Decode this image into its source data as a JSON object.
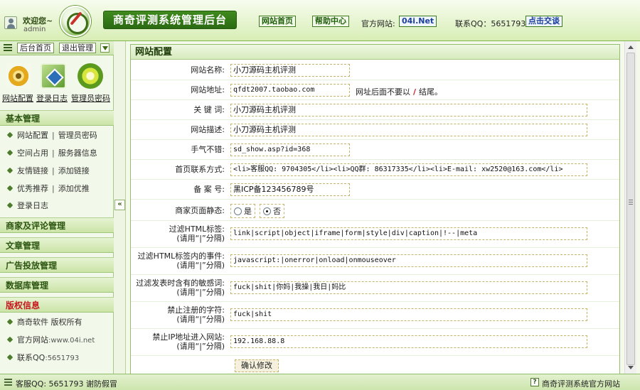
{
  "header": {
    "welcome": "欢迎您~",
    "username": "admin",
    "system_title": "商奇评测系统管理后台",
    "nav_home": "网站首页",
    "nav_help": "帮助中心",
    "official_label": "官方网站:",
    "official_site": "04i.Net",
    "qq_label": "联系QQ：5651793",
    "chat_button": "点击交谈"
  },
  "sidebar": {
    "top_buttons": [
      "后台首页",
      "退出管理"
    ],
    "quick_links": [
      "网站配置",
      "登录日志",
      "管理员密码"
    ],
    "sections": [
      {
        "title": "基本管理"
      },
      {
        "title": "商家及评论管理"
      },
      {
        "title": "文章管理"
      },
      {
        "title": "广告投放管理"
      },
      {
        "title": "数据库管理"
      },
      {
        "title": "版权信息"
      }
    ],
    "basic_items": [
      {
        "a": "网站配置",
        "b": "管理员密码"
      },
      {
        "a": "空间占用",
        "b": "服务器信息"
      },
      {
        "a": "友情链接",
        "b": "添加链接"
      },
      {
        "a": "优秀推荐",
        "b": "添加优推"
      },
      {
        "a": "登录日志",
        "b": ""
      }
    ],
    "copyright_items": [
      {
        "a": "商奇软件",
        "b": "版权所有"
      },
      {
        "a": "官方网站",
        "b": ":www.04i.net"
      },
      {
        "a": "联系QQ",
        "b": ":5651793"
      }
    ],
    "splitter_glyph": "«"
  },
  "main": {
    "panel_title": "网站配置",
    "fields": {
      "site_name": {
        "label": "网站名称:",
        "value": "小刀源码主机评测"
      },
      "site_url": {
        "label": "网站地址:",
        "value": "qfdt2007.taobao.com"
      },
      "site_url_note_a": "网址后面不要以",
      "site_url_note_slash": "/",
      "site_url_note_b": "结尾。",
      "keywords": {
        "label": "关 键 词:",
        "value": "小刀源码主机评测"
      },
      "description": {
        "label": "网站描述:",
        "value": "小刀源码主机评测"
      },
      "lucky": {
        "label": "手气不错:",
        "value": "sd_show.asp?id=368"
      },
      "contact": {
        "label": "首页联系方式:",
        "value": "<li>客服QQ: 9704305</li><li>QQ群: 86317335</li><li>E-mail: xw2520@163.com</li>"
      },
      "icp": {
        "label": "备 案 号:",
        "value": "黑ICP备123456789号"
      },
      "static": {
        "label": "商家页面静态:",
        "option_yes": "是",
        "option_no": "否"
      },
      "filter_html": {
        "label_a": "过滤HTML标签:",
        "label_b": "(请用“|”分隔)",
        "value": "link|script|object|iframe|form|style|div|caption|!--|meta"
      },
      "filter_events": {
        "label_a": "过滤HTML标签内的事件:",
        "label_b": "(请用“|”分隔)",
        "value": "javascript:|onerror|onload|onmouseover"
      },
      "filter_words": {
        "label_a": "过滤发表时含有的敏感词:",
        "label_b": "(请用“|”分隔)",
        "value": "fuck|shit|你妈|我操|我日|妈比"
      },
      "banned_chars": {
        "label_a": "禁止注册的字符:",
        "label_b": "(请用“|”分隔)",
        "value": "fuck|shit"
      },
      "banned_ip": {
        "label_a": "禁止IP地址进入网站:",
        "label_b": "(请用“|”分隔)",
        "value": "192.168.88.8"
      }
    },
    "submit": "确认修改"
  },
  "footer": {
    "left": "客服QQ: 5651793 谢防假冒",
    "help_glyph": "?",
    "right": "商奇评测系统官方网站"
  }
}
